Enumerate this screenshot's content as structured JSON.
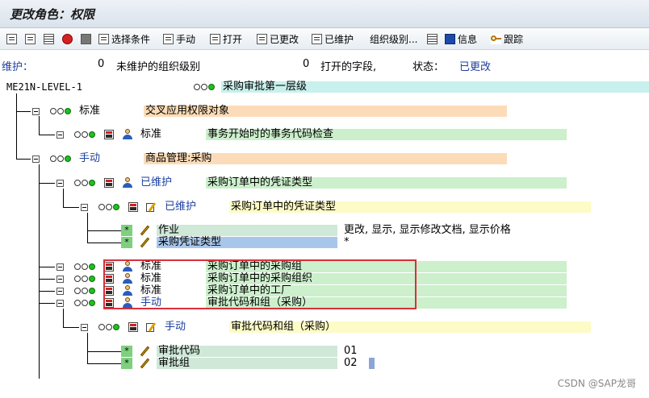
{
  "window": {
    "title": "更改角色：权限"
  },
  "toolbar": {
    "select_conditions": "选择条件",
    "manual": "手动",
    "open": "打开",
    "changed": "已更改",
    "maintained": "已维护",
    "org_levels": "组织级别...",
    "info": "信息",
    "trace": "跟踪"
  },
  "status": {
    "maint_label": "维护：",
    "unmaint_count": "0",
    "unmaint_text": "未维护的组织级别",
    "open_count": "0",
    "open_text": "打开的字段,",
    "state_label": "状态：",
    "state_value": "已更改"
  },
  "tree": {
    "root": {
      "name": "ME21N-LEVEL-1",
      "desc": "采购审批第一层级"
    },
    "n1": {
      "status": "标准",
      "desc": "交叉应用权限对象"
    },
    "n1a": {
      "status": "标准",
      "desc": "事务开始时的事务代码检查"
    },
    "n2": {
      "status": "手动",
      "desc": "商品管理:采购"
    },
    "n2a": {
      "status": "已维护",
      "desc": "采购订单中的凭证类型"
    },
    "n2a1": {
      "status": "已维护",
      "desc": "采购订单中的凭证类型"
    },
    "f1": {
      "star": "*",
      "label": "作业",
      "value": "更改, 显示, 显示修改文档, 显示价格"
    },
    "f2": {
      "star": "*",
      "label": "采购凭证类型",
      "value": "*"
    },
    "n2b": {
      "status": "标准",
      "desc": "采购订单中的采购组"
    },
    "n2c": {
      "status": "标准",
      "desc": "采购订单中的采购组织"
    },
    "n2d": {
      "status": "标准",
      "desc": "采购订单中的工厂"
    },
    "n2e": {
      "status": "手动",
      "desc": "审批代码和组（采购）"
    },
    "n2e1": {
      "status": "手动",
      "desc": "审批代码和组（采购）"
    },
    "f3": {
      "star": "*",
      "label": "审批代码",
      "value": "01"
    },
    "f4": {
      "star": "*",
      "label": "审批组",
      "value": "02"
    }
  },
  "watermark": "CSDN @SAP龙哥"
}
